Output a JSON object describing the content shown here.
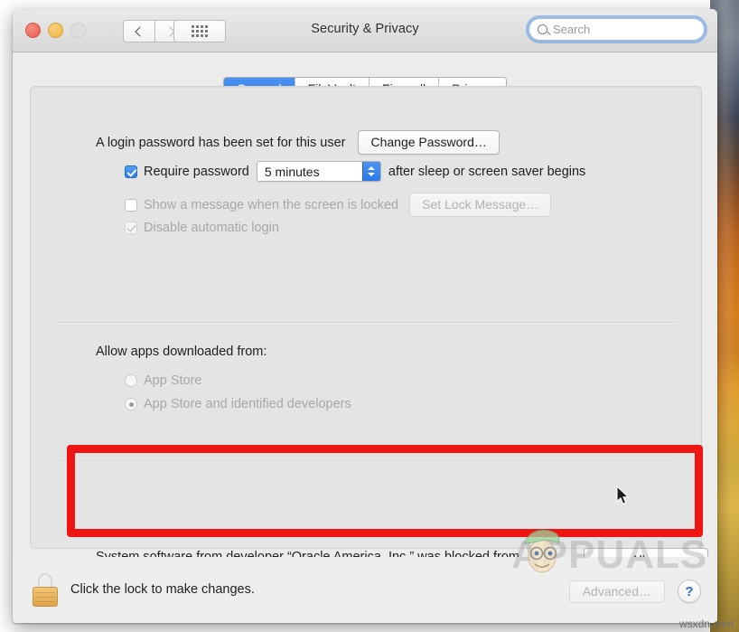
{
  "window": {
    "title": "Security & Privacy",
    "traffic_lights": [
      "close",
      "minimize",
      "zoom"
    ],
    "nav": {
      "back_icon": "chevron-left-icon",
      "forward_icon": "chevron-right-icon",
      "grid_icon": "grid-dots-icon"
    },
    "search": {
      "placeholder": "Search",
      "value": "",
      "icon": "search-icon"
    }
  },
  "tabs": [
    {
      "label": "General",
      "active": true
    },
    {
      "label": "FileVault",
      "active": false
    },
    {
      "label": "Firewall",
      "active": false
    },
    {
      "label": "Privacy",
      "active": false
    }
  ],
  "general": {
    "login_password_label": "A login password has been set for this user",
    "change_password_button": "Change Password…",
    "require_password": {
      "label": "Require password",
      "checked": true,
      "delay_value": "5 minutes",
      "suffix": "after sleep or screen saver begins"
    },
    "show_message": {
      "label": "Show a message when the screen is locked",
      "checked": false,
      "disabled": true,
      "button": "Set Lock Message…"
    },
    "disable_automatic_login": {
      "label": "Disable automatic login",
      "checked": true,
      "disabled": true
    },
    "allow_apps": {
      "heading": "Allow apps downloaded from:",
      "options": [
        {
          "label": "App Store",
          "selected": false,
          "disabled": true
        },
        {
          "label": "App Store and identified developers",
          "selected": true,
          "disabled": true
        }
      ]
    },
    "blocked_software": {
      "message": "System software from developer “Oracle America, Inc.” was blocked from loading.",
      "allow_button": "Allow",
      "highlight_color": "#ee1513"
    }
  },
  "footer": {
    "lock_icon": "lock-closed-icon",
    "lock_text": "Click the lock to make changes.",
    "advanced_button": "Advanced…",
    "help_button": "?"
  },
  "watermark": {
    "brand": "APPUALS",
    "site": "wsxdn.com"
  }
}
